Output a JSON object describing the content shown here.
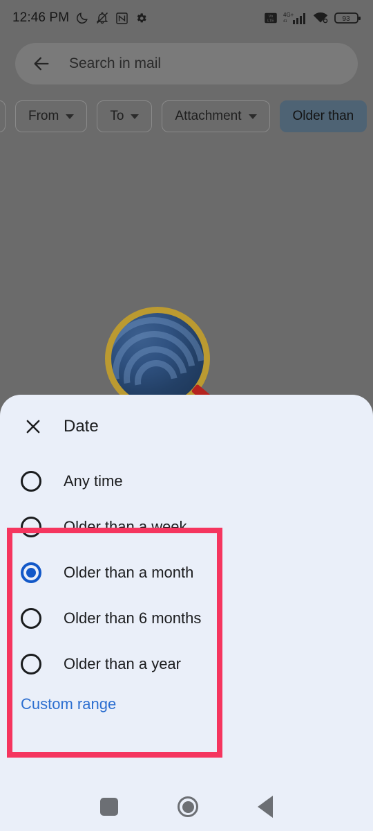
{
  "status_bar": {
    "time": "12:46 PM",
    "battery_level": "93",
    "network_type": "4G+",
    "volte_label": "VoLTE",
    "icons": [
      "do-not-disturb-moon-icon",
      "notifications-muted-icon",
      "nfc-icon",
      "settings-gear-icon",
      "volte-icon",
      "signal-bars-icon",
      "wifi-icon",
      "battery-icon"
    ]
  },
  "search": {
    "placeholder": "Search in mail",
    "back_icon": "back-arrow-icon"
  },
  "filter_chips": [
    {
      "label": "",
      "has_caret": false,
      "selected": false,
      "partial": true
    },
    {
      "label": "From",
      "has_caret": true,
      "selected": false,
      "partial": false
    },
    {
      "label": "To",
      "has_caret": true,
      "selected": false,
      "partial": false
    },
    {
      "label": "Attachment",
      "has_caret": true,
      "selected": false,
      "partial": false
    },
    {
      "label": "Older than",
      "has_caret": false,
      "selected": true,
      "partial": false
    }
  ],
  "sheet": {
    "title": "Date",
    "close_icon": "close-x-icon",
    "options": [
      {
        "label": "Any time",
        "selected": false
      },
      {
        "label": "Older than a week",
        "selected": false
      },
      {
        "label": "Older than a month",
        "selected": true
      },
      {
        "label": "Older than 6 months",
        "selected": false
      },
      {
        "label": "Older than a year",
        "selected": false
      }
    ],
    "custom_range_label": "Custom range"
  },
  "annotation": {
    "color": "#f5355f"
  },
  "nav_bar": {
    "recents_label": "recents-square-icon",
    "home_label": "home-circle-icon",
    "back_label": "back-triangle-icon"
  },
  "colors": {
    "scrim": "#6b6b6b",
    "sheet_background": "#eaeff9",
    "accent_blue": "#1258c8",
    "link_blue": "#2d6fd0",
    "chip_selected": "#4e6374",
    "annotation_pink": "#f5355f"
  }
}
